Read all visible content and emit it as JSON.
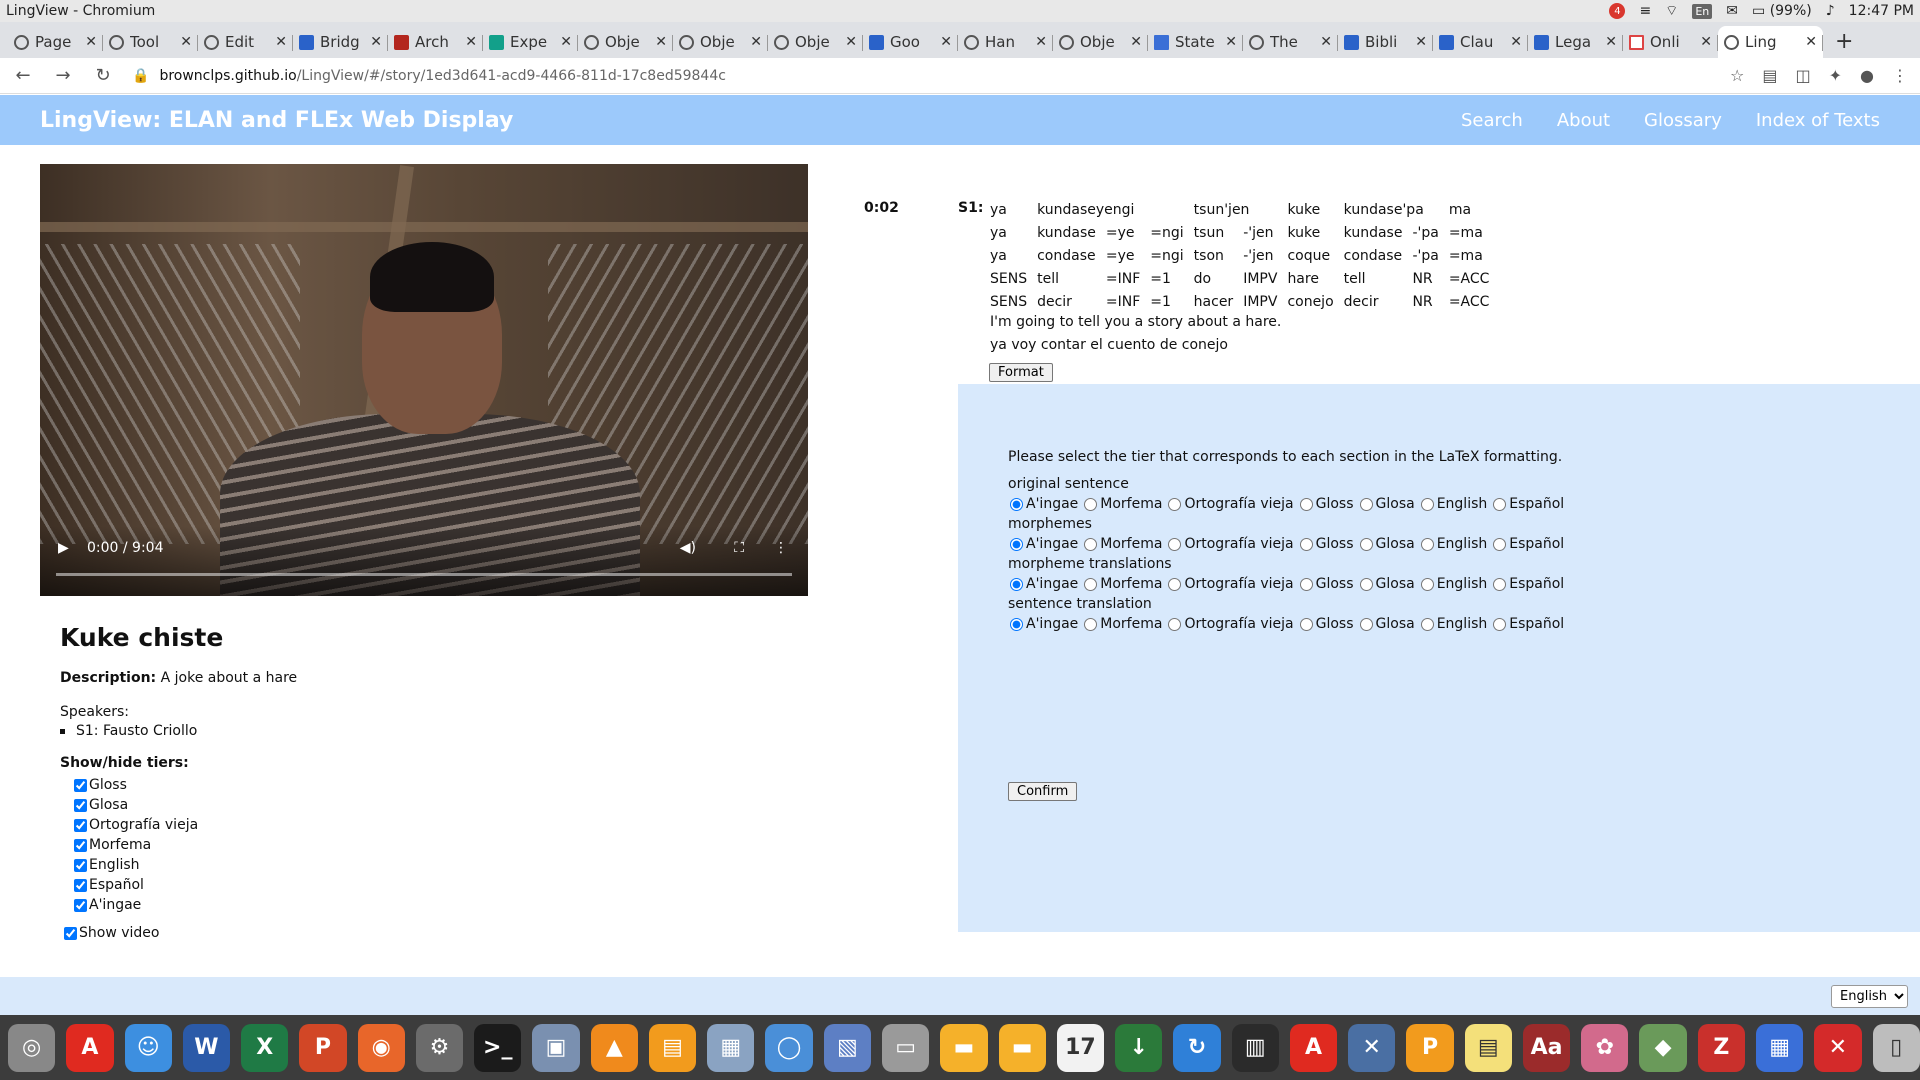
{
  "os": {
    "window_title": "LingView - Chromium",
    "notification_count": "4",
    "lang_indicator": "En",
    "battery": "(99%)",
    "clock": "12:47 PM"
  },
  "browser": {
    "tabs": [
      {
        "label": "Page",
        "icon": "generic"
      },
      {
        "label": "Tool",
        "icon": "generic"
      },
      {
        "label": "Edit",
        "icon": "generic"
      },
      {
        "label": "Bridg",
        "icon": "blue"
      },
      {
        "label": "Arch",
        "icon": "red"
      },
      {
        "label": "Expe",
        "icon": "teal"
      },
      {
        "label": "Obje",
        "icon": "generic"
      },
      {
        "label": "Obje",
        "icon": "generic"
      },
      {
        "label": "Obje",
        "icon": "generic"
      },
      {
        "label": "Goo",
        "icon": "blue"
      },
      {
        "label": "Han",
        "icon": "generic"
      },
      {
        "label": "Obje",
        "icon": "generic"
      },
      {
        "label": "State",
        "icon": "doc"
      },
      {
        "label": "The",
        "icon": "generic"
      },
      {
        "label": "Bibli",
        "icon": "blue"
      },
      {
        "label": "Clau",
        "icon": "blue"
      },
      {
        "label": "Lega",
        "icon": "blue"
      },
      {
        "label": "Onli",
        "icon": "gmail"
      },
      {
        "label": "Ling",
        "icon": "generic",
        "active": true
      }
    ],
    "url_host": "brownclps.github.io",
    "url_path": "/LingView/#/story/1ed3d641-acd9-4466-811d-17c8ed59844c"
  },
  "app": {
    "title": "LingView: ELAN and FLEx Web Display",
    "nav": [
      "Search",
      "About",
      "Glossary",
      "Index of Texts"
    ]
  },
  "video": {
    "time": "0:00 / 9:04",
    "progress": 0
  },
  "story": {
    "title": "Kuke chiste",
    "description_label": "Description:",
    "description": "A joke about a hare",
    "speakers_label": "Speakers:",
    "speakers": [
      "S1: Fausto Criollo"
    ],
    "tiers_label": "Show/hide tiers:",
    "tiers": [
      "Gloss",
      "Glosa",
      "Ortografía vieja",
      "Morfema",
      "English",
      "Español",
      "A'ingae"
    ],
    "show_video_label": "Show video"
  },
  "sentence": {
    "timestamp": "0:02",
    "speaker": "S1:",
    "words": [
      "ya",
      "kundaseyengi",
      "tsun'jen",
      "kuke",
      "kundase'pa",
      "ma"
    ],
    "morph_rows": [
      [
        "ya",
        "kundase",
        "=ye",
        "=ngi",
        "tsun",
        "-'jen",
        "kuke",
        "kundase",
        "-'pa",
        "=ma"
      ],
      [
        "ya",
        "condase",
        "=ye",
        "=ngi",
        "tson",
        "-'jen",
        "coque",
        "condase",
        "-'pa",
        "=ma"
      ],
      [
        "SENS",
        "tell",
        "=INF",
        "=1",
        "do",
        "IMPV",
        "hare",
        "tell",
        "NR",
        "=ACC"
      ],
      [
        "SENS",
        "decir",
        "=INF",
        "=1",
        "hacer",
        "IMPV",
        "conejo",
        "decir",
        "NR",
        "=ACC"
      ]
    ],
    "free_english": "I'm going to tell you a story about a hare.",
    "free_spanish": "ya voy contar el cuento de conejo",
    "format_button": "Format"
  },
  "latex": {
    "prompt": "Please select the tier that corresponds to each section in the LaTeX formatting.",
    "sections": [
      "original sentence",
      "morphemes",
      "morpheme translations",
      "sentence translation"
    ],
    "options": [
      "A'ingae",
      "Morfema",
      "Ortografía vieja",
      "Gloss",
      "Glosa",
      "English",
      "Español"
    ],
    "selected": "A'ingae",
    "confirm_button": "Confirm"
  },
  "footer": {
    "language": "English"
  },
  "dock": [
    {
      "name": "chrome-icon",
      "color": "#888888",
      "glyph": "◎"
    },
    {
      "name": "acrobat-icon",
      "color": "#e02a20",
      "glyph": "A"
    },
    {
      "name": "finder-icon",
      "color": "#3d8fe0",
      "glyph": "☺"
    },
    {
      "name": "word-icon",
      "color": "#2b5aa8",
      "glyph": "W"
    },
    {
      "name": "excel-icon",
      "color": "#1f7a45",
      "glyph": "X"
    },
    {
      "name": "powerpoint-icon",
      "color": "#d24726",
      "glyph": "P"
    },
    {
      "name": "firefox-icon",
      "color": "#e8662a",
      "glyph": "◉"
    },
    {
      "name": "settings-icon",
      "color": "#6b6b6b",
      "glyph": "⚙"
    },
    {
      "name": "terminal-icon",
      "color": "#1b1b1b",
      "glyph": ">_"
    },
    {
      "name": "preview-icon",
      "color": "#7a90b0",
      "glyph": "▣"
    },
    {
      "name": "vlc-icon",
      "color": "#f08a1c",
      "glyph": "▲"
    },
    {
      "name": "books-icon",
      "color": "#f29b1d",
      "glyph": "▤"
    },
    {
      "name": "image-capture-icon",
      "color": "#8aa3c2",
      "glyph": "▦"
    },
    {
      "name": "chromium-icon",
      "color": "#4a8fd8",
      "glyph": "◯"
    },
    {
      "name": "notes-icon",
      "color": "#5d7fc4",
      "glyph": "▧"
    },
    {
      "name": "disk-icon",
      "color": "#9a9a9a",
      "glyph": "▭"
    },
    {
      "name": "folder-icon",
      "color": "#f5b12a",
      "glyph": "▬"
    },
    {
      "name": "folder2-icon",
      "color": "#f5b12a",
      "glyph": "▬"
    },
    {
      "name": "calendar-icon",
      "color": "#f2f2f2",
      "glyph": "17"
    },
    {
      "name": "download-icon",
      "color": "#2b7a3a",
      "glyph": "↓"
    },
    {
      "name": "sync-icon",
      "color": "#2f80d8",
      "glyph": "↻"
    },
    {
      "name": "split-icon",
      "color": "#2b2b2b",
      "glyph": "▥"
    },
    {
      "name": "acrobat2-icon",
      "color": "#e02a20",
      "glyph": "A"
    },
    {
      "name": "xcode-icon",
      "color": "#4a6fa3",
      "glyph": "✕"
    },
    {
      "name": "pages-icon",
      "color": "#f29b1d",
      "glyph": "P"
    },
    {
      "name": "stickies-icon",
      "color": "#f4e07a",
      "glyph": "▤"
    },
    {
      "name": "dictionary-icon",
      "color": "#9b2b2b",
      "glyph": "Aa"
    },
    {
      "name": "wallpaper-icon",
      "color": "#d26a8c",
      "glyph": "✿"
    },
    {
      "name": "maps-icon",
      "color": "#6a9a5a",
      "glyph": "◆"
    },
    {
      "name": "zotero-icon",
      "color": "#c9302c",
      "glyph": "Z"
    },
    {
      "name": "instruments-icon",
      "color": "#3a6fd8",
      "glyph": "▦"
    },
    {
      "name": "tools-icon",
      "color": "#d42a2a",
      "glyph": "✕"
    },
    {
      "name": "trash-icon",
      "color": "#bdbdbd",
      "glyph": "▯"
    }
  ]
}
